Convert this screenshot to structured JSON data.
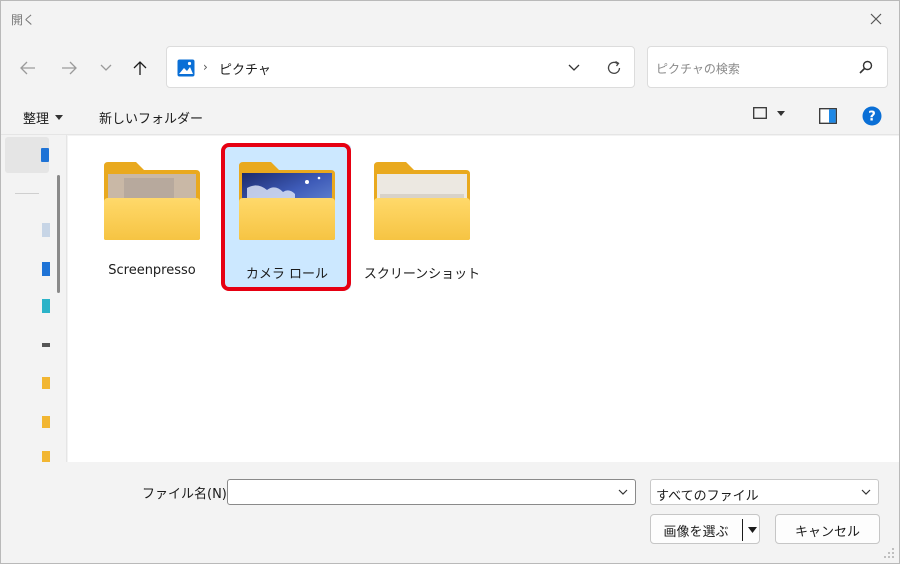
{
  "window": {
    "title": "開く"
  },
  "address": {
    "location": "ピクチャ"
  },
  "search": {
    "placeholder": "ピクチャの検索"
  },
  "toolbar": {
    "organize_label": "整理",
    "new_folder_label": "新しいフォルダー"
  },
  "folders": [
    {
      "name": "Screenpresso",
      "selected": false
    },
    {
      "name": "カメラ ロール",
      "selected": true
    },
    {
      "name": "スクリーンショット",
      "selected": false
    }
  ],
  "footer": {
    "filename_label": "ファイル名(N):",
    "filename_value": "",
    "filetype_value": "すべてのファイル",
    "open_label": "画像を選ぶ",
    "cancel_label": "キャンセル"
  },
  "colors": {
    "accent": "#0067c0",
    "selection": "#cce8ff",
    "highlight_box": "#e60012",
    "folder": "#f9c748"
  }
}
